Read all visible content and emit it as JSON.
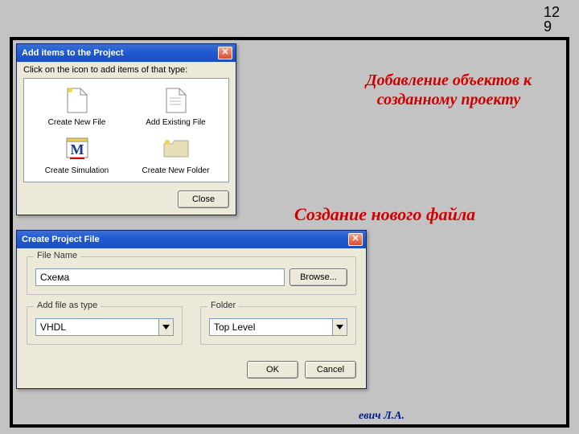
{
  "page_number_line1": "12",
  "page_number_line2": "9",
  "dlg1": {
    "title": "Add items to the Project",
    "instruction": "Click on the icon to add items of that type:",
    "items": [
      {
        "label": "Create New File"
      },
      {
        "label": "Add Existing File"
      },
      {
        "label": "Create Simulation"
      },
      {
        "label": "Create New Folder"
      }
    ],
    "close_label": "Close"
  },
  "dlg2": {
    "title": "Create Project File",
    "filename_legend": "File Name",
    "filename_value": "Схема",
    "browse_label": "Browse...",
    "type_legend": "Add file as type",
    "type_value": "VHDL",
    "folder_legend": "Folder",
    "folder_value": "Top Level",
    "ok_label": "OK",
    "cancel_label": "Cancel"
  },
  "annotation1": "Добавление объектов к созданному проекту",
  "annotation2": "Создание нового файла",
  "author": "евич Л.А."
}
